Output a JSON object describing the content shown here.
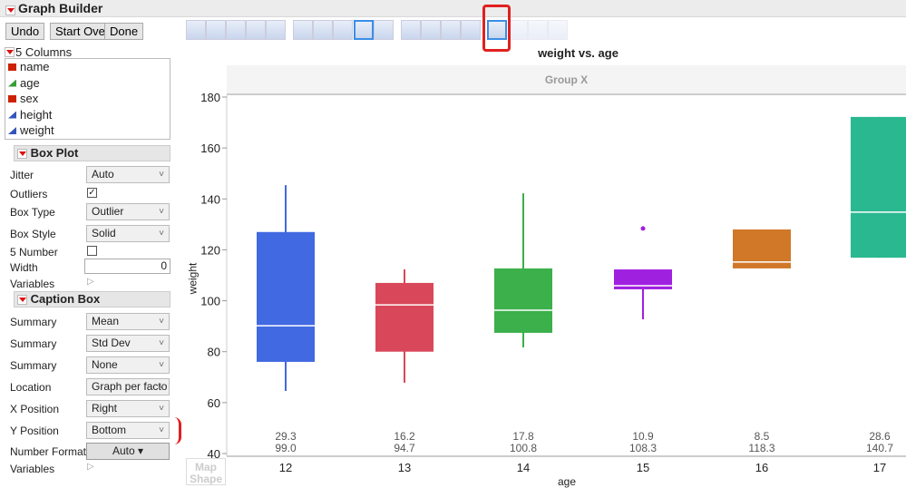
{
  "window": {
    "title": "Graph Builder"
  },
  "buttons": {
    "undo": "Undo",
    "start_over": "Start Over",
    "done": "Done"
  },
  "columns": {
    "header": "5 Columns",
    "items": [
      {
        "name": "name",
        "type": "nominal",
        "color": "#cc2200"
      },
      {
        "name": "age",
        "type": "ordinal",
        "color": "#33a033"
      },
      {
        "name": "sex",
        "type": "nominal",
        "color": "#cc2200"
      },
      {
        "name": "height",
        "type": "continuous",
        "color": "#3355bb"
      },
      {
        "name": "weight",
        "type": "continuous",
        "color": "#3355bb"
      }
    ]
  },
  "box_plot": {
    "title": "Box Plot",
    "jitter_label": "Jitter",
    "jitter": "Auto",
    "outliers_label": "Outliers",
    "outliers": true,
    "box_type_label": "Box Type",
    "box_type": "Outlier",
    "box_style_label": "Box Style",
    "box_style": "Solid",
    "five_number_label": "5 Number",
    "five_number": false,
    "width_label": "Width",
    "width": "0",
    "variables_label": "Variables"
  },
  "caption_box": {
    "title": "Caption Box",
    "summary_label": "Summary",
    "summary1": "Mean",
    "summary2": "Std Dev",
    "summary3": "None",
    "location_label": "Location",
    "location": "Graph per facto",
    "x_position_label": "X Position",
    "x_position": "Right",
    "y_position_label": "Y Position",
    "y_position": "Bottom",
    "number_format_label": "Number Format",
    "number_format": "Auto",
    "variables_label": "Variables"
  },
  "map_shape": "Map Shape",
  "chart_data": {
    "type": "box",
    "title": "weight vs. age",
    "group_label": "Group X",
    "xlabel": "age",
    "ylabel": "weight",
    "ylim": [
      40,
      180
    ],
    "yticks": [
      40,
      60,
      80,
      100,
      120,
      140,
      160,
      180
    ],
    "categories": [
      "12",
      "13",
      "14",
      "15",
      "16",
      "17"
    ],
    "colors": [
      "#4169e1",
      "#d9475a",
      "#3cb04a",
      "#a020e0",
      "#d07828",
      "#2ab890"
    ],
    "boxes": [
      {
        "whisker_high": 145.4,
        "q3": 127,
        "median": 90.2,
        "q1": 76,
        "whisker_low": 64.6,
        "outliers": []
      },
      {
        "whisker_high": 112.3,
        "q3": 107,
        "median": 98.4,
        "q1": 80,
        "whisker_low": 67.8,
        "outliers": []
      },
      {
        "whisker_high": 142.2,
        "q3": 112.7,
        "median": 96.3,
        "q1": 87.4,
        "whisker_low": 81.7,
        "outliers": []
      },
      {
        "whisker_high": 112.3,
        "q3": 112.3,
        "median": 105.9,
        "q1": 104.5,
        "whisker_low": 92.7,
        "outliers": [
          128.4
        ]
      },
      {
        "whisker_high": 128,
        "q3": 128,
        "median": 115.2,
        "q1": 112.7,
        "whisker_low": 112.7,
        "outliers": []
      },
      {
        "whisker_high": 172.2,
        "q3": 172.2,
        "median": 134.8,
        "q1": 116.9,
        "whisker_low": 116.9,
        "outliers": []
      }
    ],
    "captions": [
      {
        "std": "29.3",
        "mean": "99.0"
      },
      {
        "std": "16.2",
        "mean": "94.7"
      },
      {
        "std": "17.8",
        "mean": "100.8"
      },
      {
        "std": "10.9",
        "mean": "108.3"
      },
      {
        "std": "8.5",
        "mean": "118.3"
      },
      {
        "std": "28.6",
        "mean": "140.7"
      }
    ]
  }
}
